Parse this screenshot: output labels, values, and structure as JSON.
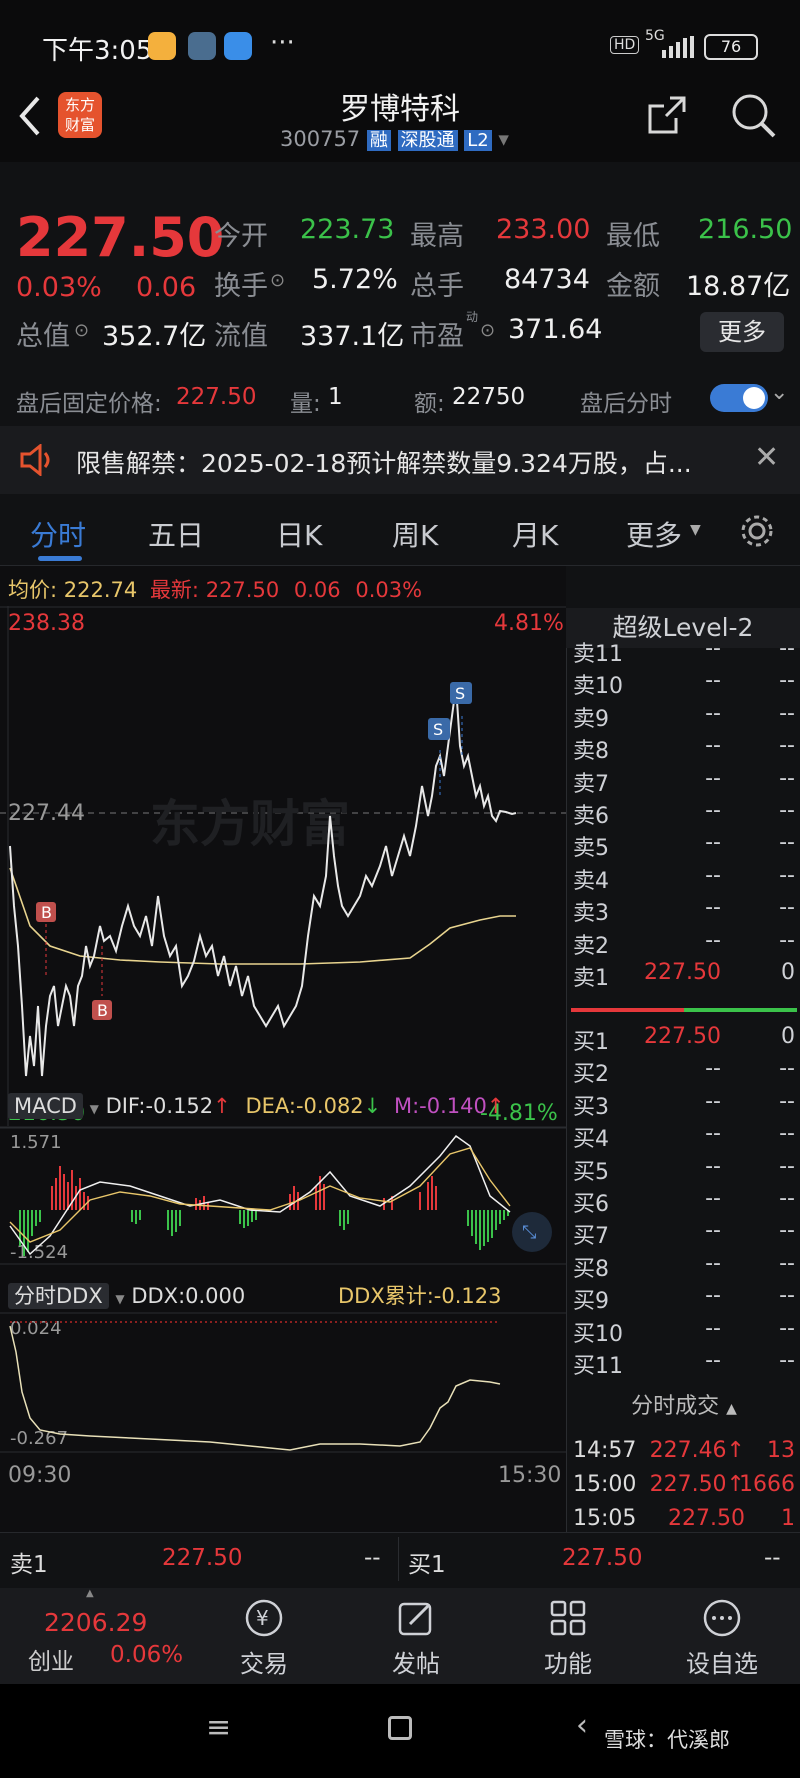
{
  "status_bar": {
    "time": "下午3:05",
    "network": "5G",
    "battery": "76"
  },
  "header": {
    "title": "罗博特科",
    "code": "300757",
    "badge_rong": "融",
    "badge_sgt": "深股通",
    "badge_l2": "L2",
    "logo_line1": "东方",
    "logo_line2": "财富"
  },
  "quote": {
    "price": "227.50",
    "change_pct": "0.03%",
    "change": "0.06",
    "open_label": "今开",
    "open": "223.73",
    "high_label": "最高",
    "high": "233.00",
    "low_label": "最低",
    "low": "216.50",
    "turnover_label": "换手",
    "turnover": "5.72%",
    "volume_label": "总手",
    "volume": "84734",
    "amount_label": "金额",
    "amount": "18.87亿",
    "total_mv_label": "总值",
    "total_mv": "352.7亿",
    "float_mv_label": "流值",
    "float_mv": "337.1亿",
    "pe_label": "市盈",
    "pe_sup": "动",
    "pe": "371.64",
    "more_label": "更多"
  },
  "after_hours": {
    "label": "盘后固定价格:",
    "price": "227.50",
    "qty_label": "量:",
    "qty": "1",
    "amt_label": "额:",
    "amt": "22750",
    "toggle_label": "盘后分时"
  },
  "notice": {
    "text": "限售解禁：2025-02-18预计解禁数量9.324万股，占..."
  },
  "tabs": [
    "分时",
    "五日",
    "日K",
    "周K",
    "月K",
    "更多"
  ],
  "active_tab": "分时",
  "intraday": {
    "avg_label": "均价:",
    "avg": "222.74",
    "last_label": "最新:",
    "last": "227.50",
    "chg": "0.06",
    "chg_pct": "0.03%",
    "y_top": "238.38",
    "y_top_pct": "4.81%",
    "y_mid": "227.44",
    "y_bottom": "216.50",
    "y_bottom_pct": "-4.81%",
    "watermark": "东方财富"
  },
  "macd": {
    "name": "MACD",
    "dif": "DIF:-0.152",
    "dea": "DEA:-0.082",
    "m": "M:-0.140",
    "top": "1.571",
    "bottom": "-1.524"
  },
  "ddx": {
    "name": "分时DDX",
    "ddx": "DDX:0.000",
    "cum": "DDX累计:-0.123",
    "top": "0.024",
    "bottom": "-0.267",
    "t_start": "09:30",
    "t_end": "15:30"
  },
  "orderbook": {
    "title": "超级Level-2",
    "sells": [
      {
        "label": "卖11",
        "price": "--",
        "vol": "--"
      },
      {
        "label": "卖10",
        "price": "--",
        "vol": "--"
      },
      {
        "label": "卖9",
        "price": "--",
        "vol": "--"
      },
      {
        "label": "卖8",
        "price": "--",
        "vol": "--"
      },
      {
        "label": "卖7",
        "price": "--",
        "vol": "--"
      },
      {
        "label": "卖6",
        "price": "--",
        "vol": "--"
      },
      {
        "label": "卖5",
        "price": "--",
        "vol": "--"
      },
      {
        "label": "卖4",
        "price": "--",
        "vol": "--"
      },
      {
        "label": "卖3",
        "price": "--",
        "vol": "--"
      },
      {
        "label": "卖2",
        "price": "--",
        "vol": "--"
      },
      {
        "label": "卖1",
        "price": "227.50",
        "vol": "0"
      }
    ],
    "buys": [
      {
        "label": "买1",
        "price": "227.50",
        "vol": "0"
      },
      {
        "label": "买2",
        "price": "--",
        "vol": "--"
      },
      {
        "label": "买3",
        "price": "--",
        "vol": "--"
      },
      {
        "label": "买4",
        "price": "--",
        "vol": "--"
      },
      {
        "label": "买5",
        "price": "--",
        "vol": "--"
      },
      {
        "label": "买6",
        "price": "--",
        "vol": "--"
      },
      {
        "label": "买7",
        "price": "--",
        "vol": "--"
      },
      {
        "label": "买8",
        "price": "--",
        "vol": "--"
      },
      {
        "label": "买9",
        "price": "--",
        "vol": "--"
      },
      {
        "label": "买10",
        "price": "--",
        "vol": "--"
      },
      {
        "label": "买11",
        "price": "--",
        "vol": "--"
      }
    ],
    "trades_title": "分时成交",
    "trades": [
      {
        "time": "14:57",
        "price": "227.46↑",
        "vol": "13"
      },
      {
        "time": "15:00",
        "price": "227.50↑",
        "vol": "1666"
      },
      {
        "time": "15:05",
        "price": "227.50",
        "vol": "1"
      }
    ]
  },
  "bottom_bid": {
    "sell_label": "卖1",
    "sell_price": "227.50",
    "sell_vol": "--",
    "buy_label": "买1",
    "buy_price": "227.50",
    "buy_vol": "--"
  },
  "bottom_nav": {
    "index_value": "2206.29",
    "index_name": "创业",
    "index_chg": "0.06%",
    "items": [
      "交易",
      "发帖",
      "功能",
      "设自选"
    ]
  },
  "watermark_footer": "雪球：代溪郎",
  "colors": {
    "up": "#e5383b",
    "down": "#3bc24a",
    "accent": "#3a7bd5"
  }
}
